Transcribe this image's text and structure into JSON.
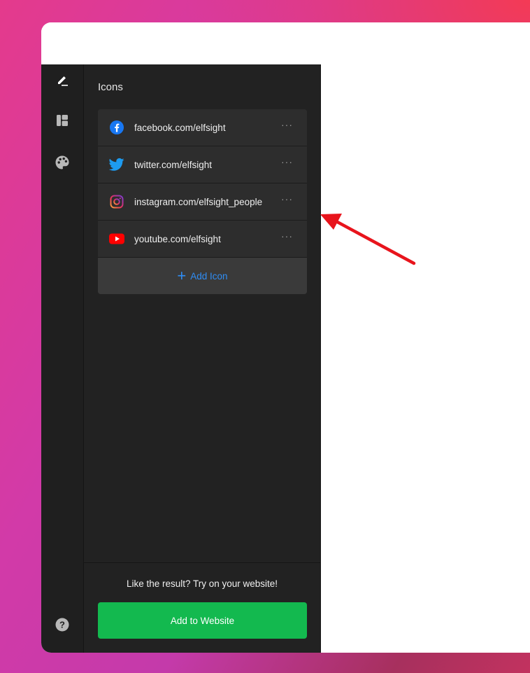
{
  "panel": {
    "title": "Icons"
  },
  "icons": [
    {
      "label": "facebook.com/elfsight",
      "icon": "facebook-icon",
      "more": "···"
    },
    {
      "label": "twitter.com/elfsight",
      "icon": "twitter-icon",
      "more": "···"
    },
    {
      "label": "instagram.com/elfsight_people",
      "icon": "instagram-icon",
      "more": "···"
    },
    {
      "label": "youtube.com/elfsight",
      "icon": "youtube-icon",
      "more": "···"
    }
  ],
  "add_icon": {
    "label": "Add Icon",
    "plus": "+"
  },
  "footer": {
    "cta_text": "Like the result? Try on your website!",
    "button_label": "Add to Website"
  },
  "rail": {
    "items": [
      "pencil-icon",
      "layout-icon",
      "palette-icon"
    ],
    "help": "help-icon"
  },
  "colors": {
    "accent": "#2f8df5",
    "cta": "#13b94f",
    "arrow": "#e8141c",
    "facebook": "#1877f2",
    "twitter": "#1d9bf0",
    "youtube": "#ff0000"
  }
}
